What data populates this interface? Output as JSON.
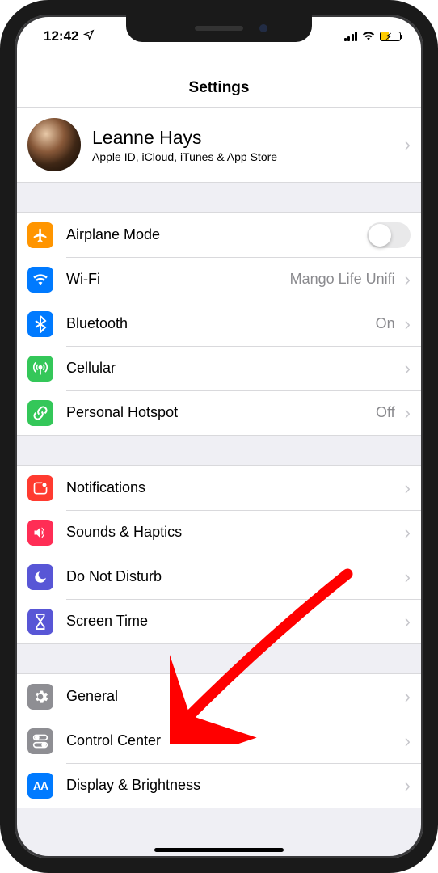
{
  "status": {
    "time": "12:42"
  },
  "header": {
    "title": "Settings"
  },
  "profile": {
    "name": "Leanne Hays",
    "subtitle": "Apple ID, iCloud, iTunes & App Store"
  },
  "groups": [
    {
      "rows": [
        {
          "id": "airplane",
          "label": "Airplane Mode",
          "type": "toggle",
          "toggle": false,
          "icon": "airplane-icon",
          "color": "c-orange"
        },
        {
          "id": "wifi",
          "label": "Wi-Fi",
          "value": "Mango Life Unifi",
          "icon": "wifi-icon",
          "color": "c-blue"
        },
        {
          "id": "bluetooth",
          "label": "Bluetooth",
          "value": "On",
          "icon": "bluetooth-icon",
          "color": "c-blue"
        },
        {
          "id": "cellular",
          "label": "Cellular",
          "icon": "antenna-icon",
          "color": "c-green"
        },
        {
          "id": "hotspot",
          "label": "Personal Hotspot",
          "value": "Off",
          "icon": "link-icon",
          "color": "c-green"
        }
      ]
    },
    {
      "rows": [
        {
          "id": "notifications",
          "label": "Notifications",
          "icon": "notification-icon",
          "color": "c-red"
        },
        {
          "id": "sounds",
          "label": "Sounds & Haptics",
          "icon": "speaker-icon",
          "color": "c-pink"
        },
        {
          "id": "dnd",
          "label": "Do Not Disturb",
          "icon": "moon-icon",
          "color": "c-indigo"
        },
        {
          "id": "screentime",
          "label": "Screen Time",
          "icon": "hourglass-icon",
          "color": "c-indigo"
        }
      ]
    },
    {
      "rows": [
        {
          "id": "general",
          "label": "General",
          "icon": "gear-icon",
          "color": "c-gray"
        },
        {
          "id": "controlcenter",
          "label": "Control Center",
          "icon": "switches-icon",
          "color": "c-darkgray"
        },
        {
          "id": "display",
          "label": "Display & Brightness",
          "icon": "textsize-icon",
          "color": "c-blue"
        }
      ]
    }
  ]
}
